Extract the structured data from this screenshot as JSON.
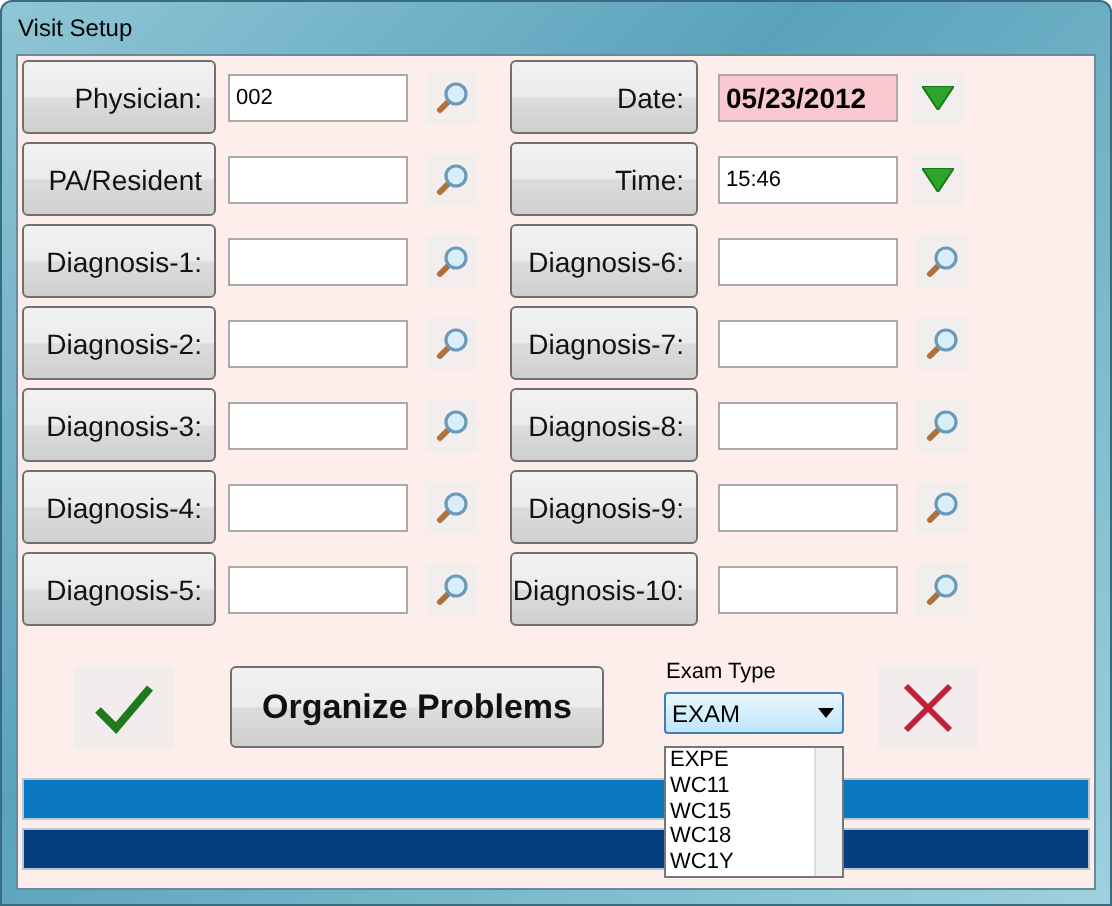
{
  "window": {
    "title": "Visit  Setup"
  },
  "left_column": [
    {
      "label": "Physician:",
      "value": "002",
      "kind": "search",
      "highlighted": false
    },
    {
      "label": "PA/Resident",
      "kind": "search",
      "highlighted": false
    },
    {
      "label": "Diagnosis-1:",
      "kind": "search",
      "highlighted": false
    },
    {
      "label": "Diagnosis-2:",
      "kind": "search",
      "highlighted": false
    },
    {
      "label": "Diagnosis-3:",
      "kind": "search",
      "highlighted": false
    },
    {
      "label": "Diagnosis-4:",
      "kind": "search",
      "highlighted": false
    },
    {
      "label": "Diagnosis-5:",
      "kind": "search",
      "highlighted": false
    }
  ],
  "right_column": [
    {
      "label": "Date:",
      "value": "05/23/2012",
      "kind": "dropdown",
      "highlighted": true
    },
    {
      "label": "Time:",
      "value": "15:46",
      "kind": "dropdown",
      "highlighted": false
    },
    {
      "label": "Diagnosis-6:",
      "kind": "search",
      "highlighted": false
    },
    {
      "label": "Diagnosis-7:",
      "kind": "search",
      "highlighted": false
    },
    {
      "label": "Diagnosis-8:",
      "kind": "search",
      "highlighted": false
    },
    {
      "label": "Diagnosis-9:",
      "kind": "search",
      "highlighted": false
    },
    {
      "label": "Diagnosis-10:",
      "kind": "search",
      "highlighted": false
    }
  ],
  "organize_button": "Organize Problems",
  "exam_type": {
    "label": "Exam Type",
    "value": "EXAM",
    "expanded": true,
    "options": [
      "EXPE",
      "WC11",
      "WC15",
      "WC18",
      "WC1Y"
    ]
  }
}
